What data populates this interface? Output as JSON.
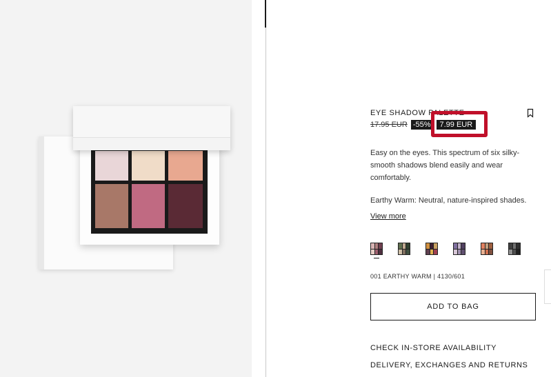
{
  "product": {
    "title": "EYE SHADOW PALETTE",
    "old_price": "17.95 EUR",
    "discount": "-55%",
    "new_price": "7.99 EUR",
    "description": "Easy on the eyes. This spectrum of six silky-smooth shadows blend easily and wear comfortably.",
    "shade_description": "Earthy Warm: Neutral, nature-inspired shades.",
    "view_more_label": "View more",
    "reference": "001 EARTHY WARM | 4130/601",
    "add_to_bag_label": "ADD TO BAG",
    "check_store_label": "CHECK IN-STORE AVAILABILITY",
    "delivery_label": "DELIVERY, EXCHANGES AND RETURNS"
  },
  "icons": {
    "bookmark": "bookmark-icon"
  },
  "colors": {
    "highlight": "#c0102a",
    "price_badge": "#1a1a1a"
  },
  "palette_shades": [
    "#e9d6d8",
    "#f0dcc8",
    "#e8a890",
    "#a87868",
    "#c06a82",
    "#5a2a35"
  ],
  "swatches": [
    {
      "name": "earthy-warm",
      "colors": [
        "#d8b4b4",
        "#b08080",
        "#704050",
        "#e8d0c8",
        "#a06070",
        "#503040"
      ],
      "selected": true
    },
    {
      "name": "green",
      "colors": [
        "#607050",
        "#c0a890",
        "#304030",
        "#d0c0a8",
        "#807060",
        "#405040"
      ],
      "selected": false
    },
    {
      "name": "gold",
      "colors": [
        "#d09040",
        "#402030",
        "#c8a060",
        "#604050",
        "#e0b050",
        "#a04050"
      ],
      "selected": false
    },
    {
      "name": "violet",
      "colors": [
        "#8070a0",
        "#c0b0c8",
        "#504060",
        "#d8c8d8",
        "#a090b0",
        "#605070"
      ],
      "selected": false
    },
    {
      "name": "coral",
      "colors": [
        "#e08060",
        "#c0a080",
        "#a06040",
        "#e8b090",
        "#d07050",
        "#805040"
      ],
      "selected": false
    },
    {
      "name": "smoky",
      "colors": [
        "#404040",
        "#707070",
        "#303030",
        "#909090",
        "#505050",
        "#202020"
      ],
      "selected": false
    }
  ]
}
